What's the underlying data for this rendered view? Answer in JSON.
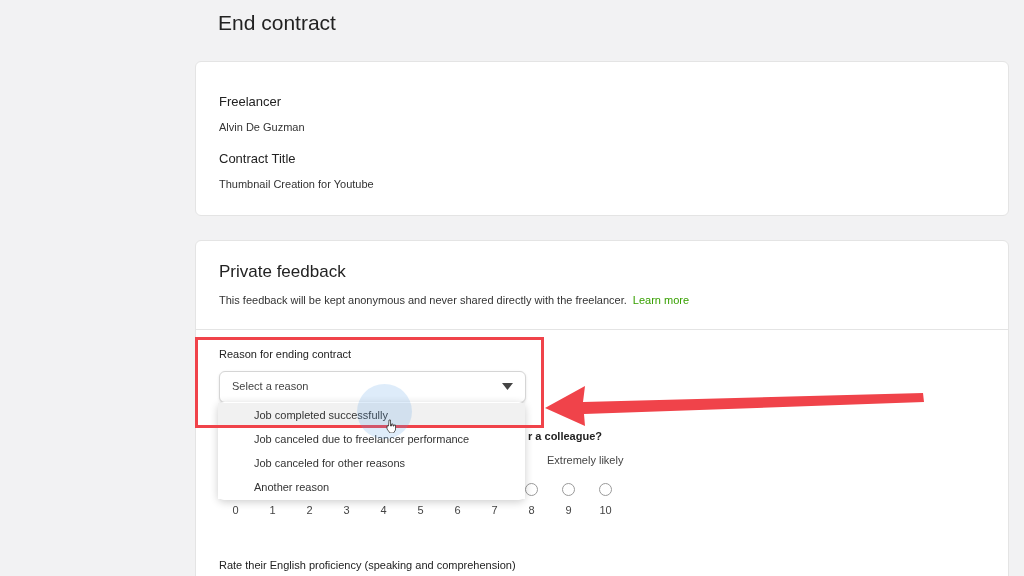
{
  "page": {
    "title": "End contract"
  },
  "contract_card": {
    "fields": [
      {
        "label": "Freelancer",
        "value": "Alvin De Guzman"
      },
      {
        "label": "Contract Title",
        "value": "Thumbnail Creation for Youtube"
      }
    ]
  },
  "feedback_card": {
    "title": "Private feedback",
    "description": "This feedback will be kept anonymous and never shared directly with the freelancer.",
    "link": "Learn more",
    "reason": {
      "label": "Reason for ending contract",
      "placeholder": "Select a reason",
      "expanded": true,
      "options": [
        {
          "label": "Job completed successfully",
          "hovered": true
        },
        {
          "label": "Job canceled due to freelancer performance",
          "hovered": false
        },
        {
          "label": "Job canceled for other reasons",
          "hovered": false
        },
        {
          "label": "Another reason",
          "hovered": false
        }
      ]
    },
    "recommend": {
      "question": "r a colleague?",
      "high_label": "Extremely likely",
      "scale": [
        "0",
        "1",
        "2",
        "3",
        "4",
        "5",
        "6",
        "7",
        "8",
        "9",
        "10"
      ],
      "radios": [
        {
          "selected": false
        },
        {
          "selected": false
        },
        {
          "selected": false
        }
      ]
    },
    "english": {
      "label": "Rate their English proficiency (speaking and comprehension)"
    }
  }
}
